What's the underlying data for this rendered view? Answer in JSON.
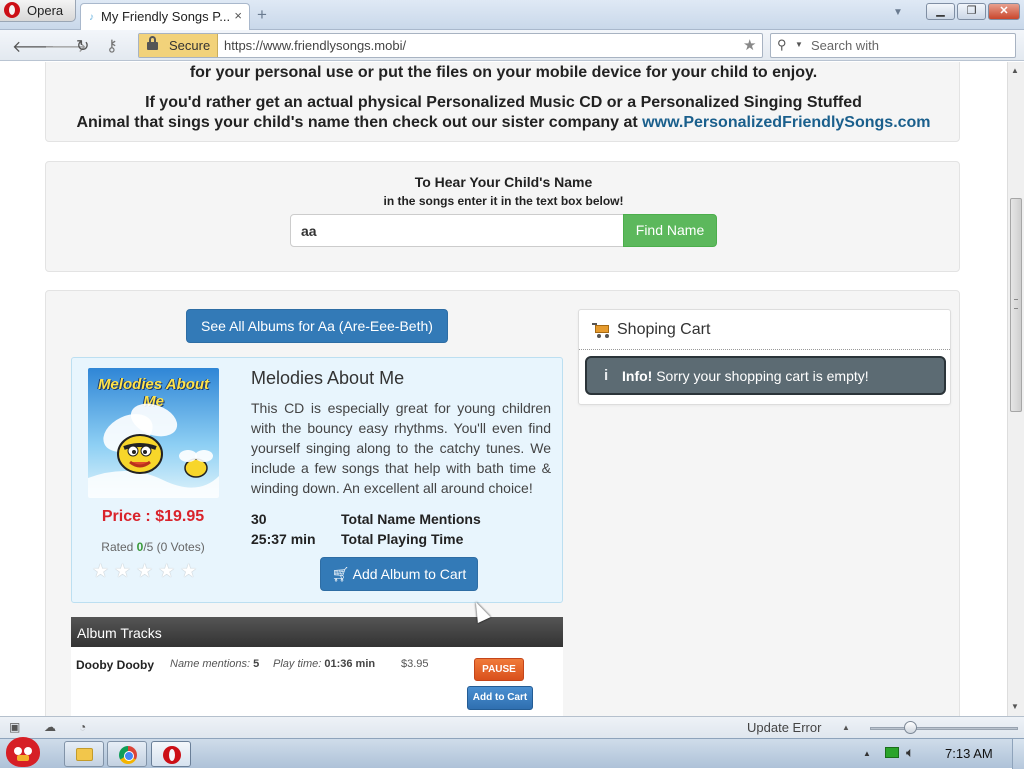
{
  "browser": {
    "menu_label": "Opera",
    "tab_title": "My Friendly Songs P...",
    "tab_close": "×",
    "new_tab": "+",
    "url": "https://www.friendlysongs.mobi/",
    "secure_label": "Secure",
    "search_placeholder": "Search with",
    "window_min": "▁",
    "window_max": "❐",
    "window_close": "✕"
  },
  "page": {
    "intro_line1": "for your personal use or put the files on your mobile device for your child to enjoy.",
    "intro_line2": "If you'd rather get an actual physical Personalized Music CD or a Personalized Singing Stuffed",
    "intro_line3_text": "Animal that sings your child's name then check out our sister company at ",
    "intro_link": "www.PersonalizedFriendlySongs.com",
    "name_search": {
      "title": "To Hear Your Child's Name",
      "subtitle": "in the songs enter it in the text box below!",
      "value": "aa",
      "button": "Find Name"
    },
    "see_all_button": "See All Albums for Aa (Are-Eee-Beth)",
    "album": {
      "cover_text": "Melodies About Me",
      "title": "Melodies About Me",
      "description": "This CD is especially great for young children with the bouncy easy rhythms. You'll even find yourself singing along to the catchy tunes. We include a few songs that help with bath time & winding down. An excellent all around choice!",
      "price": "Price : $19.95",
      "rated_prefix": "Rated ",
      "rated_value": "0",
      "rated_suffix": "/5 (0 Votes)",
      "rating_value": 0,
      "rating_max": 5,
      "stars": "★★★★★",
      "mentions_value": "30",
      "mentions_label": "Total Name Mentions",
      "time_value": "25:37 min",
      "time_label": "Total Playing Time",
      "add_button": "Add Album to Cart"
    },
    "tracks": {
      "header": "Album Tracks",
      "items": [
        {
          "name": "Dooby Dooby",
          "mentions_label": "Name mentions:",
          "mentions": "5",
          "time_label": "Play time:",
          "time": "01:36 min",
          "price": "$3.95",
          "pause_label": "PAUSE",
          "cart_label": "Add to Cart"
        }
      ]
    },
    "cart": {
      "title": "Shoping Cart",
      "info_bold": "Info!",
      "info_text": " Sorry your shopping cart is empty!"
    }
  },
  "statusbar": {
    "update_text": "Update Error"
  },
  "taskbar": {
    "clock": "7:13 AM"
  },
  "colors": {
    "primary_button": "#337ab7",
    "success_button": "#5cb85c",
    "price_red": "#d9232b",
    "album_card_bg": "#e8f5fd",
    "cart_alert_bg": "#5c6b73"
  }
}
